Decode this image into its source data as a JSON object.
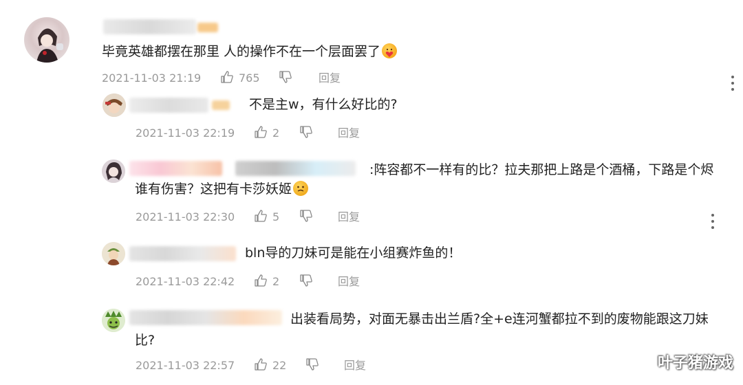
{
  "comments": [
    {
      "text": "毕竟英雄都摆在那里 人的操作不在一个层面罢了",
      "timestamp": "2021-11-03 21:19",
      "likes": "765",
      "reply_label": "回复",
      "emoji": "heart-face-emoji"
    },
    {
      "text": "不是主w，有什么好比的?",
      "timestamp": "2021-11-03 22:19",
      "likes": "2",
      "reply_label": "回复"
    },
    {
      "text_line1": ":阵容都不一样有的比？拉夫那把上路是个酒桶，下路是个烬",
      "text_line2": "谁有伤害？这把有卡莎妖姬",
      "timestamp": "2021-11-03 22:30",
      "likes": "5",
      "reply_label": "回复",
      "emoji": "awkward-face-emoji"
    },
    {
      "text": "bln导的刀妹可是能在小组赛炸鱼的！",
      "timestamp": "2021-11-03 22:42",
      "likes": "2",
      "reply_label": "回复"
    },
    {
      "text_line1": "出装看局势，对面无暴击出兰盾?全+e连河蟹都拉不到的废物能跟这刀妹",
      "text_line2": "比?",
      "timestamp": "2021-11-03 22:57",
      "likes": "22",
      "reply_label": "回复"
    }
  ],
  "watermark": "叶子猪游戏",
  "icons": {
    "like": "thumbs-up-icon",
    "dislike": "thumbs-down-icon",
    "more": "more-vertical-icon"
  }
}
